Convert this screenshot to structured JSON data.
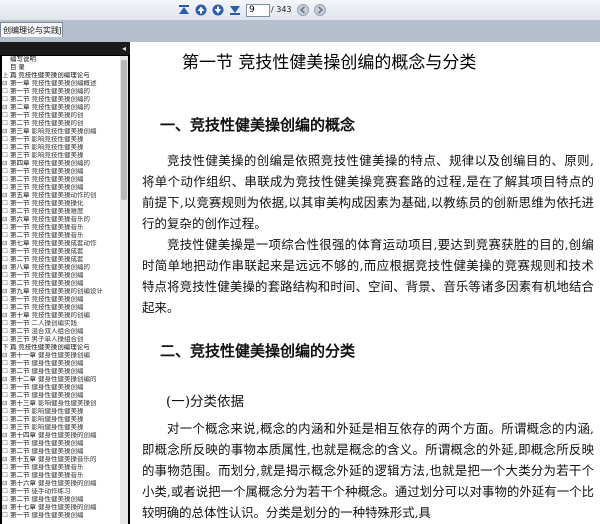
{
  "toolbar": {
    "page_current": "9",
    "page_total": "/ 343",
    "colors": {
      "nav_icon": "#2a5db0"
    }
  },
  "tab": {
    "title": "创编理论与实践]..."
  },
  "sidebar": {
    "collapse_glyph": "◂",
    "items": [
      {
        "prefix": "",
        "label": "编写说明",
        "sub": ""
      },
      {
        "prefix": "",
        "label": "目  录",
        "sub": ""
      },
      {
        "prefix": "上",
        "label": "篇  竞技性健美操创编理论与",
        "sub": ""
      },
      {
        "prefix": "⊟",
        "label": "第一章",
        "sub": "竞技性健美操创编概述"
      },
      {
        "prefix": "☐",
        "label": "第一节",
        "sub": "竞技性健美操创编的"
      },
      {
        "prefix": "☐",
        "label": "第二节",
        "sub": "竞技性健美操创编的"
      },
      {
        "prefix": "⊟",
        "label": "第二章",
        "sub": "竞技性健美操创编的"
      },
      {
        "prefix": "☐",
        "label": "第一节",
        "sub": "竞技性健美操的创"
      },
      {
        "prefix": "☐",
        "label": "第二节",
        "sub": "竞技性健美操的创"
      },
      {
        "prefix": "⊟",
        "label": "第三章",
        "sub": "影响竞技性健美操创编"
      },
      {
        "prefix": "☐",
        "label": "第一节",
        "sub": "影响竞技性健美操"
      },
      {
        "prefix": "☐",
        "label": "第二节",
        "sub": "影响竞技性健美操"
      },
      {
        "prefix": "☐",
        "label": "第三节",
        "sub": "影响竞技性健美操"
      },
      {
        "prefix": "⊟",
        "label": "第四章",
        "sub": "竞技性健美操创编的"
      },
      {
        "prefix": "☐",
        "label": "第一节",
        "sub": "竞技性健美操创编"
      },
      {
        "prefix": "☐",
        "label": "第二节",
        "sub": "竞技性健美操创编"
      },
      {
        "prefix": "☐",
        "label": "第三节",
        "sub": "竞技性健美操创编"
      },
      {
        "prefix": "⊟",
        "label": "第五章",
        "sub": "竞技性健美操动作的创"
      },
      {
        "prefix": "☐",
        "label": "第一节",
        "sub": "竞技性健美操操化"
      },
      {
        "prefix": "☐",
        "label": "第二节",
        "sub": "竞技性健美操难度"
      },
      {
        "prefix": "⊟",
        "label": "第六章",
        "sub": "竞技性健美操音乐的"
      },
      {
        "prefix": "☐",
        "label": "第一节",
        "sub": "竞技性健美操音乐"
      },
      {
        "prefix": "☐",
        "label": "第二节",
        "sub": "竞技性健美操音乐"
      },
      {
        "prefix": "⊟",
        "label": "第七章",
        "sub": "竞技性健美操成套动作"
      },
      {
        "prefix": "☐",
        "label": "第一节",
        "sub": "竞技性健美操成套"
      },
      {
        "prefix": "☐",
        "label": "第二节",
        "sub": "竞技性健美操成套"
      },
      {
        "prefix": "⊟",
        "label": "第八章",
        "sub": "竞技性健美操创编的"
      },
      {
        "prefix": "☐",
        "label": "第一节",
        "sub": "竞技性健美操创编"
      },
      {
        "prefix": "☐",
        "label": "第二节",
        "sub": "竞技性健美操创编"
      },
      {
        "prefix": "⊟",
        "label": "第九章",
        "sub": "竞技性健美操的创编设计"
      },
      {
        "prefix": "☐",
        "label": "第一节",
        "sub": "竞技性健美操创编"
      },
      {
        "prefix": "☐",
        "label": "第二节",
        "sub": "竞技性健美操创编"
      },
      {
        "prefix": "⊟",
        "label": "第十章",
        "sub": "竞技性健美操的创编"
      },
      {
        "prefix": "☐",
        "label": "第一节",
        "sub": "二人操创编实践"
      },
      {
        "prefix": "☐",
        "label": "第二节",
        "sub": "混合双人组合创编"
      },
      {
        "prefix": "☐",
        "label": "第三节",
        "sub": "男子单人操组合创"
      },
      {
        "prefix": "下",
        "label": "篇  竞技性健美操创编理论与",
        "sub": ""
      },
      {
        "prefix": "⊟",
        "label": "第十一章",
        "sub": "健身性健美操创编"
      },
      {
        "prefix": "☐",
        "label": "第一节",
        "sub": "健身性健美操创编"
      },
      {
        "prefix": "☐",
        "label": "第二节",
        "sub": "健身性健美操创编"
      },
      {
        "prefix": "⊟",
        "label": "第十二章",
        "sub": "健身性健美操创编的"
      },
      {
        "prefix": "☐",
        "label": "第一节",
        "sub": "健身性健美操创编"
      },
      {
        "prefix": "☐",
        "label": "第二节",
        "sub": "健身性健美操创编"
      },
      {
        "prefix": "⊟",
        "label": "第十三章",
        "sub": "影响健身性健美操创"
      },
      {
        "prefix": "☐",
        "label": "第一节",
        "sub": "影响健身性健美操"
      },
      {
        "prefix": "☐",
        "label": "第二节",
        "sub": "影响健身性健美操"
      },
      {
        "prefix": "☐",
        "label": "第三节",
        "sub": "影响健身性健美操"
      },
      {
        "prefix": "⊟",
        "label": "第十四章",
        "sub": "健身性健美操的创编"
      },
      {
        "prefix": "☐",
        "label": "第一节",
        "sub": "健身性健美操创编"
      },
      {
        "prefix": "☐",
        "label": "第二节",
        "sub": "健身性健美操创编"
      },
      {
        "prefix": "⊟",
        "label": "第十五章",
        "sub": "健身性健美操音乐的"
      },
      {
        "prefix": "☐",
        "label": "第一节",
        "sub": "健身性健美操音乐"
      },
      {
        "prefix": "☐",
        "label": "第二节",
        "sub": "健身性健美操音乐"
      },
      {
        "prefix": "⊟",
        "label": "第十六章",
        "sub": "健身性健美操的创编"
      },
      {
        "prefix": "☐",
        "label": "第一节",
        "sub": "徒手动作练习"
      },
      {
        "prefix": "☐",
        "label": "第二节",
        "sub": "健身性健美操创编"
      },
      {
        "prefix": "⊟",
        "label": "第十七章",
        "sub": "健身性健美操的创编"
      },
      {
        "prefix": "☐",
        "label": "第一节",
        "sub": "健身性健美操创编"
      }
    ]
  },
  "document": {
    "chapter_title": "第一节    竞技性健美操创编的概念与分类",
    "heading1": "一、竞技性健美操创编的概念",
    "para1": "竞技性健美操的创编是依照竞技性健美操的特点、规律以及创编目的、原则,将单个动作组织、串联成为竞技性健美操竞赛套路的过程,是在了解其项目特点的前提下,以竞赛规则为依据,以其审美构成因素为基础,以教练员的创新思维为依托进行的复杂的创作过程。",
    "para2": "竞技性健美操是一项综合性很强的体育运动项目,要达到竞赛获胜的目的,创编时简单地把动作串联起来是远远不够的,而应根据竞技性健美操的竞赛规则和技术特点将竞技性健美操的套路结构和时间、空间、背景、音乐等诸多因素有机地结合起来。",
    "heading2": "二、竞技性健美操创编的分类",
    "subheading": "(一)分类依据",
    "para3": "对一个概念来说,概念的内涵和外延是相互依存的两个方面。所谓概念的内涵,即概念所反映的事物本质属性,也就是概念的含义。所谓概念的外延,即概念所反映的事物范围。而划分,就是揭示概念外延的逻辑方法,也就是把一个大类分为若干个小类,或者说把一个属概念分为若干个种概念。通过划分可以对事物的外延有一个比较明确的总体性认识。分类是划分的一种特殊形式,具"
  }
}
